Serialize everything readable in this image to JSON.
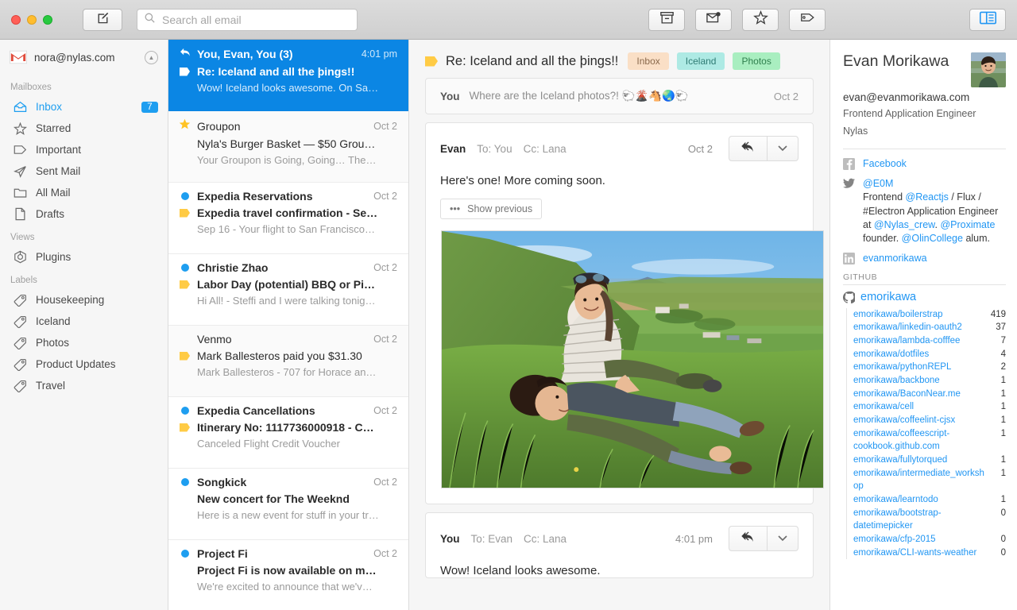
{
  "toolbar": {
    "compose_icon": "compose-pencil-icon",
    "search_placeholder": "Search all email",
    "search_value": "",
    "archive_icon": "archive-icon",
    "unread_icon": "mark-unread-icon",
    "star_icon": "star-icon",
    "label_icon": "label-tag-icon",
    "panel_toggle_icon": "sidebar-panel-toggle-icon"
  },
  "sidebar": {
    "account_email": "nora@nylas.com",
    "account_icon": "gmail-logo-icon",
    "collapse_icon": "chevron-up-icon",
    "sections": [
      {
        "title": "Mailboxes",
        "items": [
          {
            "label": "Inbox",
            "icon": "inbox-icon",
            "badge": "7",
            "active": true
          },
          {
            "label": "Starred",
            "icon": "star-icon",
            "badge": "",
            "active": false
          },
          {
            "label": "Important",
            "icon": "tag-outline-icon",
            "badge": "",
            "active": false
          },
          {
            "label": "Sent Mail",
            "icon": "paper-plane-icon",
            "badge": "",
            "active": false
          },
          {
            "label": "All Mail",
            "icon": "folder-icon",
            "badge": "",
            "active": false
          },
          {
            "label": "Drafts",
            "icon": "page-icon",
            "badge": "",
            "active": false
          }
        ]
      },
      {
        "title": "Views",
        "items": [
          {
            "label": "Plugins",
            "icon": "plugins-icon",
            "badge": "",
            "active": false
          }
        ]
      },
      {
        "title": "Labels",
        "items": [
          {
            "label": "Housekeeping",
            "icon": "label-tag-icon",
            "badge": "",
            "active": false
          },
          {
            "label": "Iceland",
            "icon": "label-tag-icon",
            "badge": "",
            "active": false
          },
          {
            "label": "Photos",
            "icon": "label-tag-icon",
            "badge": "",
            "active": false
          },
          {
            "label": "Product Updates",
            "icon": "label-tag-icon",
            "badge": "",
            "active": false
          },
          {
            "label": "Travel",
            "icon": "label-tag-icon",
            "badge": "",
            "active": false
          }
        ]
      }
    ]
  },
  "threads": [
    {
      "from": "You, Evan, You (3)",
      "date": "4:01 pm",
      "subject": "Re: Iceland and all the þings!!",
      "snippet": "Wow! Iceland looks awesome. On Sa…",
      "mark": "reply-arrow-icon",
      "subject_mark": "tag-white-icon",
      "selected": true,
      "read": false
    },
    {
      "from": "Groupon",
      "date": "Oct 2",
      "subject": "Nyla's Burger Basket — $50 Grou…",
      "snippet": "Your Groupon is Going, Going… The…",
      "mark": "star-filled-icon",
      "subject_mark": "",
      "selected": false,
      "read": true
    },
    {
      "from": "Expedia Reservations",
      "date": "Oct 2",
      "subject": "Expedia travel confirmation - Se…",
      "snippet": "Sep 16 - Your flight to San Francisco…",
      "mark": "unread-dot-icon",
      "subject_mark": "tag-yellow-icon",
      "selected": false,
      "read": false
    },
    {
      "from": "Christie Zhao",
      "date": "Oct 2",
      "subject": "Labor Day (potential) BBQ or Pi…",
      "snippet": "Hi All! - Steffi and I were talking tonig…",
      "mark": "unread-dot-icon",
      "subject_mark": "tag-yellow-icon",
      "selected": false,
      "read": false
    },
    {
      "from": "Venmo",
      "date": "Oct 2",
      "subject": "Mark Ballesteros paid you $31.30",
      "snippet": "Mark Ballesteros - 707 for Horace an…",
      "mark": "",
      "subject_mark": "tag-yellow-icon",
      "selected": false,
      "read": true
    },
    {
      "from": "Expedia Cancellations",
      "date": "Oct 2",
      "subject": "Itinerary No: 1117736000918 - C…",
      "snippet": "Canceled Flight Credit Voucher",
      "mark": "unread-dot-icon",
      "subject_mark": "tag-yellow-icon",
      "selected": false,
      "read": false
    },
    {
      "from": "Songkick",
      "date": "Oct 2",
      "subject": "New concert for The Weeknd",
      "snippet": "Here is a new event for stuff in your tr…",
      "mark": "unread-dot-icon",
      "subject_mark": "",
      "selected": false,
      "read": false
    },
    {
      "from": "Project Fi",
      "date": "Oct 2",
      "subject": "Project Fi is now available on m…",
      "snippet": "We're excited to announce that we'v…",
      "mark": "unread-dot-icon",
      "subject_mark": "",
      "selected": false,
      "read": false
    }
  ],
  "conversation": {
    "subject": "Re: Iceland and all the þings!!",
    "subject_tag_icon": "tag-yellow-icon",
    "labels": [
      {
        "name": "Inbox",
        "bg": "#fadfc6",
        "fg": "#8a6a4d"
      },
      {
        "name": "Iceland",
        "bg": "#aeeae4",
        "fg": "#2f7b74"
      },
      {
        "name": "Photos",
        "bg": "#a9eec0",
        "fg": "#2f7f4d"
      }
    ],
    "collapsed_message": {
      "who": "You",
      "snippet": "Where are the Iceland photos?! 🐑🌋🐴🌏🐑",
      "date": "Oct 2"
    },
    "messages": [
      {
        "from": "Evan",
        "to": "To: You",
        "cc": "Cc: Lana",
        "date": "Oct 2",
        "body": "Here's one! More coming soon.",
        "show_previous_label": "Show previous",
        "reply_icon": "reply-all-icon",
        "dropdown_icon": "chevron-down-icon",
        "has_photo": true,
        "photo_alt": "Two people resting on a green Icelandic hillside overlooking farmland"
      },
      {
        "from": "You",
        "to": "To: Evan",
        "cc": "Cc: Lana",
        "date": "4:01 pm",
        "body": "Wow! Iceland looks awesome.",
        "show_previous_label": "",
        "reply_icon": "reply-all-icon",
        "dropdown_icon": "chevron-down-icon",
        "has_photo": false
      }
    ]
  },
  "contact": {
    "name": "Evan Morikawa",
    "email": "evan@evanmorikawa.com",
    "role": "Frontend Application Engineer",
    "company": "Nylas",
    "avatar_icon": "contact-avatar",
    "facebook": {
      "icon": "facebook-icon",
      "label": "Facebook"
    },
    "twitter": {
      "icon": "twitter-icon",
      "handle": "@E0M",
      "bio_parts": [
        {
          "t": "Frontend ",
          "link": false
        },
        {
          "t": "@Reactjs",
          "link": true
        },
        {
          "t": " / Flux / #Electron Application Engineer at ",
          "link": false
        },
        {
          "t": "@Nylas_crew",
          "link": true
        },
        {
          "t": ". ",
          "link": false
        },
        {
          "t": "@Proximate",
          "link": true
        },
        {
          "t": " founder. ",
          "link": false
        },
        {
          "t": "@OlinCollege",
          "link": true
        },
        {
          "t": " alum.",
          "link": false
        }
      ]
    },
    "linkedin": {
      "icon": "linkedin-icon",
      "label": "evanmorikawa"
    },
    "github": {
      "section_title": "GITHUB",
      "icon": "github-icon",
      "username": "emorikawa",
      "repos": [
        {
          "name": "emorikawa/boilerstrap",
          "count": "419"
        },
        {
          "name": "emorikawa/linkedin-oauth2",
          "count": "37"
        },
        {
          "name": "emorikawa/lambda-cofffee",
          "count": "7"
        },
        {
          "name": "emorikawa/dotfiles",
          "count": "4"
        },
        {
          "name": "emorikawa/pythonREPL",
          "count": "2"
        },
        {
          "name": "emorikawa/backbone",
          "count": "1"
        },
        {
          "name": "emorikawa/BaconNear.me",
          "count": "1"
        },
        {
          "name": "emorikawa/cell",
          "count": "1"
        },
        {
          "name": "emorikawa/coffeelint-cjsx",
          "count": "1"
        },
        {
          "name": "emorikawa/coffeescript-cookbook.github.com",
          "count": "1"
        },
        {
          "name": "emorikawa/fullytorqued",
          "count": "1"
        },
        {
          "name": "emorikawa/intermediate_workshop",
          "count": "1"
        },
        {
          "name": "emorikawa/learntodo",
          "count": "1"
        },
        {
          "name": "emorikawa/bootstrap-datetimepicker",
          "count": "0"
        },
        {
          "name": "emorikawa/cfp-2015",
          "count": "0"
        },
        {
          "name": "emorikawa/CLI-wants-weather",
          "count": "0"
        }
      ]
    }
  }
}
